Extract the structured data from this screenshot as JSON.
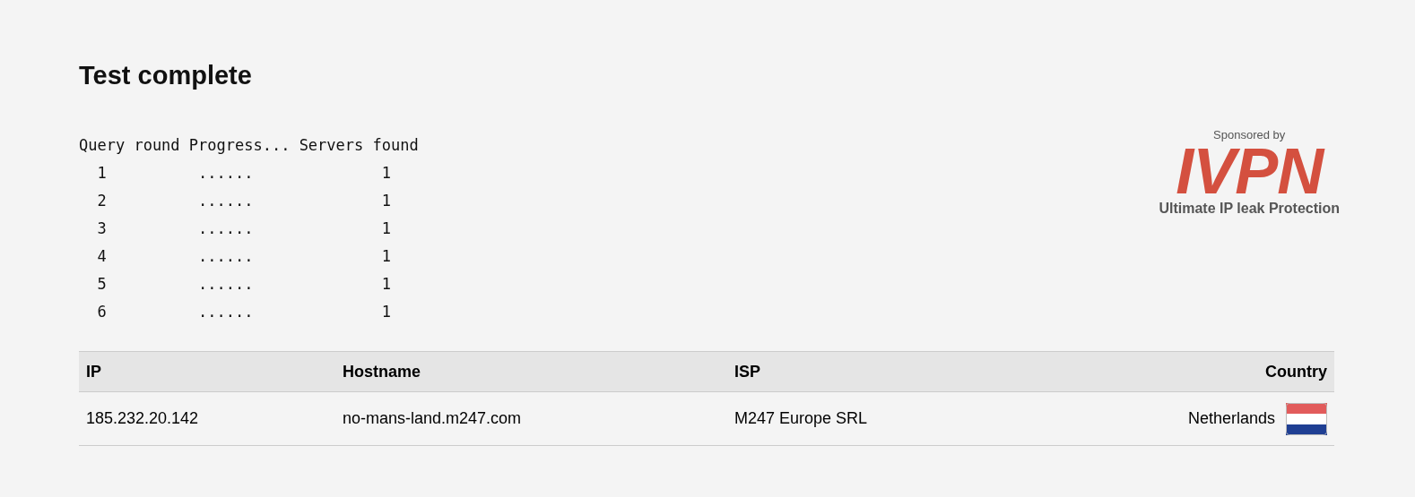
{
  "title": "Test complete",
  "query_table": {
    "header": "Query round Progress... Servers found",
    "rows": [
      {
        "round": "1",
        "progress": "......",
        "servers": "1"
      },
      {
        "round": "2",
        "progress": "......",
        "servers": "1"
      },
      {
        "round": "3",
        "progress": "......",
        "servers": "1"
      },
      {
        "round": "4",
        "progress": "......",
        "servers": "1"
      },
      {
        "round": "5",
        "progress": "......",
        "servers": "1"
      },
      {
        "round": "6",
        "progress": "......",
        "servers": "1"
      }
    ]
  },
  "sponsor": {
    "label": "Sponsored by",
    "logo": "IVPN",
    "tagline": "Ultimate IP leak Protection"
  },
  "results": {
    "columns": [
      "IP",
      "Hostname",
      "ISP",
      "Country"
    ],
    "rows": [
      {
        "ip": "185.232.20.142",
        "hostname": "no-mans-land.m247.com",
        "isp": "M247 Europe SRL",
        "country": "Netherlands"
      }
    ]
  }
}
